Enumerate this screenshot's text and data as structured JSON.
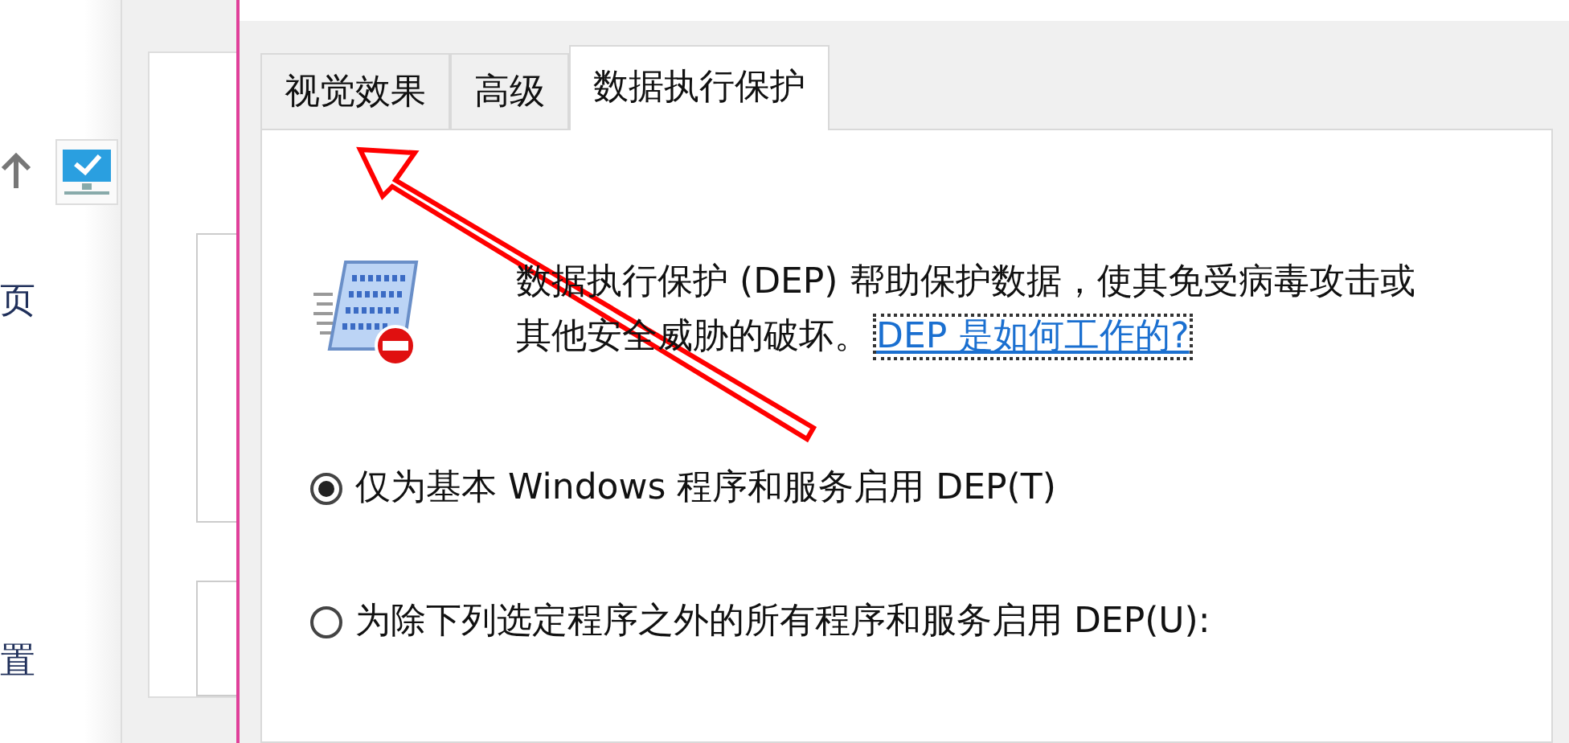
{
  "background_window": {
    "items": [
      {
        "label": "页"
      },
      {
        "label": "置"
      }
    ]
  },
  "dialog": {
    "tabs": [
      {
        "label": "视觉效果",
        "selected": false
      },
      {
        "label": "高级",
        "selected": false
      },
      {
        "label": "数据执行保护",
        "selected": true
      }
    ],
    "description": "数据执行保护 (DEP) 帮助保护数据，使其免受病毒攻击或其他安全威胁的破坏。",
    "link": "DEP 是如何工作的?",
    "options": [
      {
        "label": "仅为基本 Windows 程序和服务启用 DEP(T)",
        "selected": true
      },
      {
        "label": "为除下列选定程序之外的所有程序和服务启用 DEP(U):",
        "selected": false
      }
    ]
  }
}
